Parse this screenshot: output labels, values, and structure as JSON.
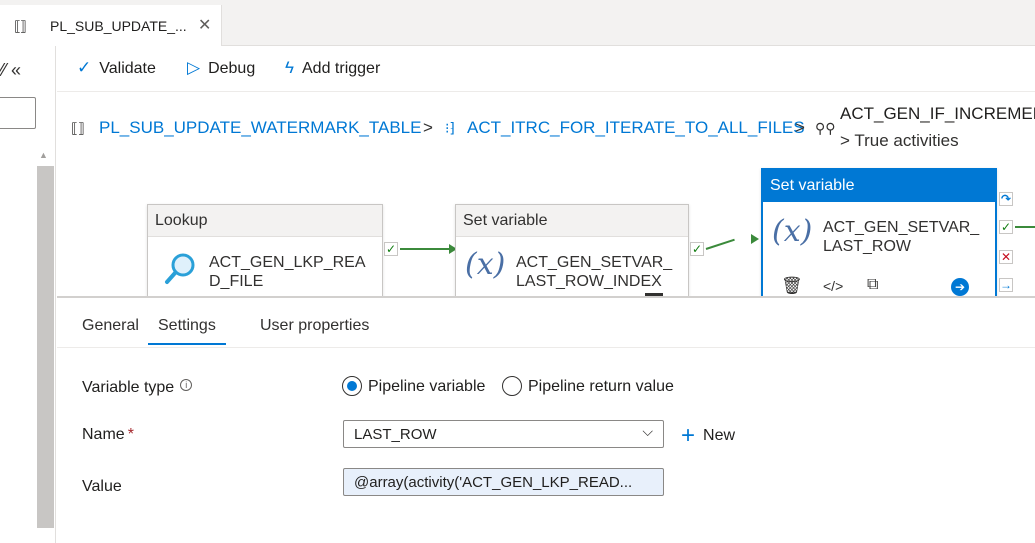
{
  "tab": {
    "icon": "pipeline-icon",
    "title": "PL_SUB_UPDATE_...",
    "close": "✕"
  },
  "sidebar": {
    "collapse_label": "⁄⁄ «"
  },
  "toolbar": {
    "validate": "Validate",
    "debug": "Debug",
    "add_trigger": "Add trigger"
  },
  "breadcrumb": {
    "items": [
      {
        "icon": "pipeline-icon",
        "label": "PL_SUB_UPDATE_WATERMARK_TABLE"
      },
      {
        "icon": "foreach-icon",
        "label": "ACT_ITRC_FOR_ITERATE_TO_ALL_FILES"
      },
      {
        "icon": "if-condition-icon",
        "label": "ACT_GEN_IF_INCREMENTAL"
      }
    ],
    "separator": ">",
    "tail": "> True activities"
  },
  "canvas": {
    "nodes": [
      {
        "type": "Lookup",
        "name_line1": "ACT_GEN_LKP_REA",
        "name_line2": "D_FILE",
        "icon": "search-icon"
      },
      {
        "type": "Set variable",
        "name_line1": "ACT_GEN_SETVAR_",
        "name_line2": "LAST_ROW_INDEX",
        "icon": "variable-icon"
      },
      {
        "type": "Set variable",
        "name_line1": "ACT_GEN_SETVAR_",
        "name_line2": "LAST_ROW",
        "icon": "variable-icon",
        "selected": true
      }
    ]
  },
  "panel": {
    "tabs": [
      "General",
      "Settings",
      "User properties"
    ],
    "active_tab": "Settings",
    "variable_type_label": "Variable type",
    "variable_type_options": [
      "Pipeline variable",
      "Pipeline return value"
    ],
    "variable_type_selected": "Pipeline variable",
    "name_label": "Name",
    "name_required": "*",
    "name_value": "LAST_ROW",
    "new_label": "New",
    "value_label": "Value",
    "value_text": "@array(activity('ACT_GEN_LKP_READ..."
  }
}
